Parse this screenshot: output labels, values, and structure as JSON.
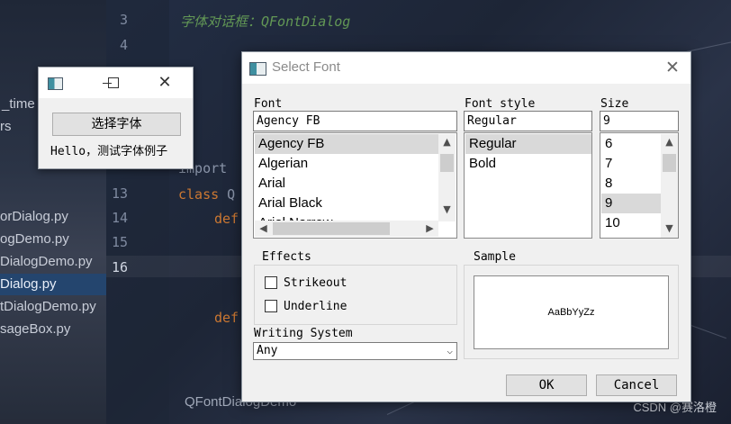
{
  "ide": {
    "line_numbers": [
      "3",
      "4",
      "13",
      "14",
      "15",
      "16"
    ],
    "comment_line": "字体对话框：QFontDialog",
    "code_import": "import",
    "code_class_kw": "class",
    "code_class_rest": " Q",
    "code_def_1": "def",
    "code_def_2": "def",
    "project_files": [
      "_time",
      "rs",
      "orDialog.py",
      "ogDemo.py",
      "DialogDemo.py",
      "Dialog.py",
      "tDialogDemo.py",
      "sageBox.py"
    ],
    "bottom_tab": "QFontDialogDemo",
    "watermark": "CSDN @赛洛橙"
  },
  "mini_window": {
    "button_label": "选择字体",
    "label_text": "Hello，测试字体例子"
  },
  "dialog": {
    "title": "Select Font",
    "font_label": "Font",
    "font_value": "Agency FB",
    "font_list": [
      {
        "label": "Agency FB",
        "selected": true
      },
      {
        "label": "Algerian",
        "selected": false
      },
      {
        "label": "Arial",
        "selected": false
      },
      {
        "label": "Arial Black",
        "selected": false
      },
      {
        "label": "Arial Narrow",
        "selected": false
      }
    ],
    "style_label": "Font style",
    "style_value": "Regular",
    "style_list": [
      {
        "label": "Regular",
        "selected": true
      },
      {
        "label": "Bold",
        "selected": false
      }
    ],
    "size_label": "Size",
    "size_value": "9",
    "size_list": [
      {
        "label": "6",
        "selected": false
      },
      {
        "label": "7",
        "selected": false
      },
      {
        "label": "8",
        "selected": false
      },
      {
        "label": "9",
        "selected": true
      },
      {
        "label": "10",
        "selected": false
      }
    ],
    "effects_label": "Effects",
    "strikeout_label": "Strikeout",
    "underline_label": "Underline",
    "strikeout_checked": false,
    "underline_checked": false,
    "sample_label": "Sample",
    "sample_text": "AaBbYyZz",
    "writing_system_label": "Writing System",
    "writing_system_value": "Any",
    "ok_label": "OK",
    "cancel_label": "Cancel"
  }
}
